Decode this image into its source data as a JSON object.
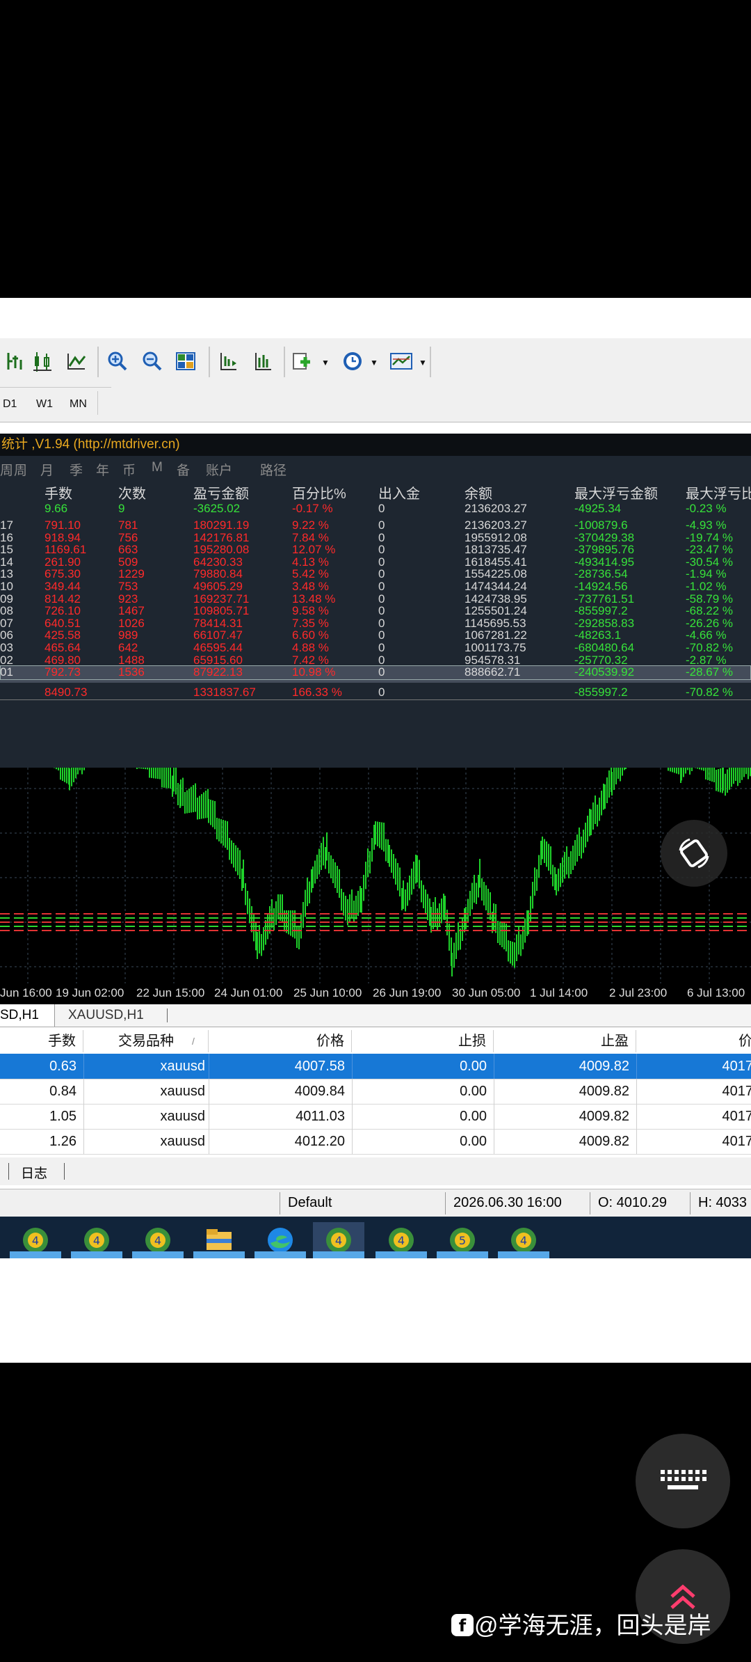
{
  "stats": {
    "title": "统计 ,V1.94 (http://mtdriver.cn)",
    "tabs": [
      "周",
      "月",
      "季",
      "年",
      "币",
      "M",
      "备",
      "账户",
      "路径"
    ],
    "headers": [
      "手数",
      "次数",
      "盈亏金额",
      "百分比%",
      "出入金",
      "余额",
      "最大浮亏金额",
      "最大浮亏比"
    ],
    "summary": {
      "lots": "9.66",
      "count": "9",
      "profit": "-3625.02",
      "pct": "-0.17 %",
      "inout": "0",
      "balance": "2136203.27",
      "maxdd": "-4925.34",
      "maxddpct": "-0.23 %"
    },
    "rows": [
      {
        "label": "17",
        "lots": "791.10",
        "count": "781",
        "profit": "180291.19",
        "pct": "9.22 %",
        "inout": "0",
        "balance": "2136203.27",
        "maxdd": "-100879.6",
        "maxddpct": "-4.93 %"
      },
      {
        "label": "16",
        "lots": "918.94",
        "count": "756",
        "profit": "142176.81",
        "pct": "7.84 %",
        "inout": "0",
        "balance": "1955912.08",
        "maxdd": "-370429.38",
        "maxddpct": "-19.74 %"
      },
      {
        "label": "15",
        "lots": "1169.61",
        "count": "663",
        "profit": "195280.08",
        "pct": "12.07 %",
        "inout": "0",
        "balance": "1813735.47",
        "maxdd": "-379895.76",
        "maxddpct": "-23.47 %"
      },
      {
        "label": "14",
        "lots": "261.90",
        "count": "509",
        "profit": "64230.33",
        "pct": "4.13 %",
        "inout": "0",
        "balance": "1618455.41",
        "maxdd": "-493414.95",
        "maxddpct": "-30.54 %"
      },
      {
        "label": "13",
        "lots": "675.30",
        "count": "1229",
        "profit": "79880.84",
        "pct": "5.42 %",
        "inout": "0",
        "balance": "1554225.08",
        "maxdd": "-28736.54",
        "maxddpct": "-1.94 %"
      },
      {
        "label": "10",
        "lots": "349.44",
        "count": "753",
        "profit": "49605.29",
        "pct": "3.48 %",
        "inout": "0",
        "balance": "1474344.24",
        "maxdd": "-14924.56",
        "maxddpct": "-1.02 %"
      },
      {
        "label": "09",
        "lots": "814.42",
        "count": "923",
        "profit": "169237.71",
        "pct": "13.48 %",
        "inout": "0",
        "balance": "1424738.95",
        "maxdd": "-737761.51",
        "maxddpct": "-58.79 %"
      },
      {
        "label": "08",
        "lots": "726.10",
        "count": "1467",
        "profit": "109805.71",
        "pct": "9.58 %",
        "inout": "0",
        "balance": "1255501.24",
        "maxdd": "-855997.2",
        "maxddpct": "-68.22 %"
      },
      {
        "label": "07",
        "lots": "640.51",
        "count": "1026",
        "profit": "78414.31",
        "pct": "7.35 %",
        "inout": "0",
        "balance": "1145695.53",
        "maxdd": "-292858.83",
        "maxddpct": "-26.26 %"
      },
      {
        "label": "06",
        "lots": "425.58",
        "count": "989",
        "profit": "66107.47",
        "pct": "6.60 %",
        "inout": "0",
        "balance": "1067281.22",
        "maxdd": "-48263.1",
        "maxddpct": "-4.66 %"
      },
      {
        "label": "03",
        "lots": "465.64",
        "count": "642",
        "profit": "46595.44",
        "pct": "4.88 %",
        "inout": "0",
        "balance": "1001173.75",
        "maxdd": "-680480.64",
        "maxddpct": "-70.82 %"
      },
      {
        "label": "02",
        "lots": "469.80",
        "count": "1488",
        "profit": "65915.60",
        "pct": "7.42 %",
        "inout": "0",
        "balance": "954578.31",
        "maxdd": "-25770.32",
        "maxddpct": "-2.87 %"
      },
      {
        "label": "01",
        "lots": "792.73",
        "count": "1536",
        "profit": "87922.13",
        "pct": "10.98 %",
        "inout": "0",
        "balance": "888662.71",
        "maxdd": "-240539.92",
        "maxddpct": "-28.67 %"
      }
    ],
    "total": {
      "lots": "8490.73",
      "profit": "1331837.67",
      "pct": "166.33 %",
      "inout": "0",
      "maxdd": "-855997.2",
      "maxddpct": "-70.82 %"
    }
  },
  "toolbar": {
    "periods": [
      "D1",
      "W1",
      "MN"
    ]
  },
  "chart": {
    "xlabels": [
      "Jun 16:00",
      "19 Jun 02:00",
      "22 Jun 15:00",
      "24 Jun 01:00",
      "25 Jun 10:00",
      "26 Jun 19:00",
      "30 Jun 05:00",
      "1 Jul 14:00",
      "2 Jul 23:00",
      "6 Jul 13:00"
    ],
    "line_color": "#1fd12a",
    "level_red": "#e23333",
    "level_green": "#2fd62f"
  },
  "chart_tabs": [
    "SD,H1",
    "XAUUSD,H1"
  ],
  "orders": {
    "headers": {
      "lots": "手数",
      "symbol": "交易品种",
      "price": "价格",
      "sl": "止损",
      "tp": "止盈",
      "cur": "价"
    },
    "rows": [
      {
        "lots": "0.63",
        "symbol": "xauusd",
        "price": "4007.58",
        "sl": "0.00",
        "tp": "4009.82",
        "cur": "4017"
      },
      {
        "lots": "0.84",
        "symbol": "xauusd",
        "price": "4009.84",
        "sl": "0.00",
        "tp": "4009.82",
        "cur": "4017"
      },
      {
        "lots": "1.05",
        "symbol": "xauusd",
        "price": "4011.03",
        "sl": "0.00",
        "tp": "4009.82",
        "cur": "4017"
      },
      {
        "lots": "1.26",
        "symbol": "xauusd",
        "price": "4012.20",
        "sl": "0.00",
        "tp": "4009.82",
        "cur": "4017"
      }
    ]
  },
  "bottom_tab": "日志",
  "status": {
    "profile": "Default",
    "datetime": "2026.06.30 16:00",
    "open": "O: 4010.29",
    "high": "H: 4033"
  },
  "watermark": "@学海无涯，回头是岸"
}
